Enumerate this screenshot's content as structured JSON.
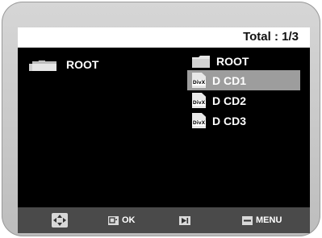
{
  "header": {
    "total_label": "Total : 1/3"
  },
  "left_panel": {
    "folder_label": "ROOT"
  },
  "file_list": {
    "items": [
      {
        "label": "ROOT",
        "type": "folder",
        "icon": "folder-icon"
      },
      {
        "label": "D CD1",
        "type": "divx",
        "icon": "divx-file-icon",
        "selected": true
      },
      {
        "label": "D CD2",
        "type": "divx",
        "icon": "divx-file-icon"
      },
      {
        "label": "D CD3",
        "type": "divx",
        "icon": "divx-file-icon"
      }
    ],
    "file_tag": "DivX"
  },
  "footer": {
    "ok_label": "OK",
    "menu_label": "MENU",
    "icons": [
      "navigate-icon",
      "ok-icon",
      "next-icon",
      "menu-icon"
    ]
  },
  "colors": {
    "screen_bg": "#000000",
    "header_bg": "#ffffff",
    "selection_bg": "#9d9d9d",
    "footer_bg": "#4a4a4a",
    "frame": "#cccccc"
  }
}
